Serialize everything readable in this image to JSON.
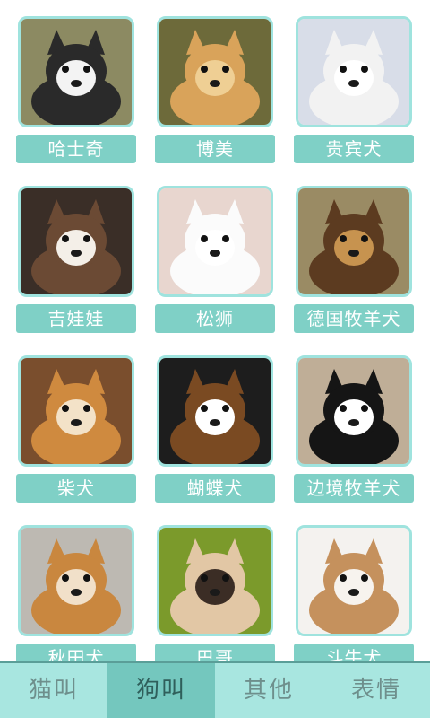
{
  "breeds": [
    {
      "label": "哈士奇",
      "icon": "husky-photo",
      "fur": "#2a2a2a",
      "face": "#f3f3f3",
      "bg": "#8c8a62"
    },
    {
      "label": "博美",
      "icon": "pomeranian-photo",
      "fur": "#d9a35a",
      "face": "#efcf94",
      "bg": "#6d6a3a"
    },
    {
      "label": "贵宾犬",
      "icon": "poodle-photo",
      "fur": "#f2f2f2",
      "face": "#ffffff",
      "bg": "#d8dde8"
    },
    {
      "label": "吉娃娃",
      "icon": "husky-puppy-photo",
      "fur": "#6b4a34",
      "face": "#f4efe8",
      "bg": "#3a2e27"
    },
    {
      "label": "松狮",
      "icon": "white-puppy-photo",
      "fur": "#fbfbfb",
      "face": "#ffffff",
      "bg": "#e8d6cf"
    },
    {
      "label": "德国牧羊犬",
      "icon": "german-shepherd-photo",
      "fur": "#5c3b20",
      "face": "#c7934f",
      "bg": "#9a8b64"
    },
    {
      "label": "柴犬",
      "icon": "shiba-photo",
      "fur": "#cf8a3f",
      "face": "#f3e2c8",
      "bg": "#7a4e2d"
    },
    {
      "label": "蝴蝶犬",
      "icon": "papillon-photo",
      "fur": "#7a4a22",
      "face": "#ffffff",
      "bg": "#1d1d1d"
    },
    {
      "label": "边境牧羊犬",
      "icon": "border-collie-photo",
      "fur": "#151515",
      "face": "#ffffff",
      "bg": "#bfae97"
    },
    {
      "label": "秋田犬",
      "icon": "akita-photo",
      "fur": "#c9873f",
      "face": "#f1e0c9",
      "bg": "#bdb9b2"
    },
    {
      "label": "巴哥",
      "icon": "pug-photo",
      "fur": "#e2c7a5",
      "face": "#3b2d25",
      "bg": "#7b9a2b"
    },
    {
      "label": "斗牛犬",
      "icon": "bulldog-photo",
      "fur": "#c5915d",
      "face": "#f7f3ee",
      "bg": "#f4f2ef"
    }
  ],
  "tabs": [
    {
      "label": "猫叫",
      "active": false
    },
    {
      "label": "狗叫",
      "active": true
    },
    {
      "label": "其他",
      "active": false
    },
    {
      "label": "表情",
      "active": false
    }
  ]
}
